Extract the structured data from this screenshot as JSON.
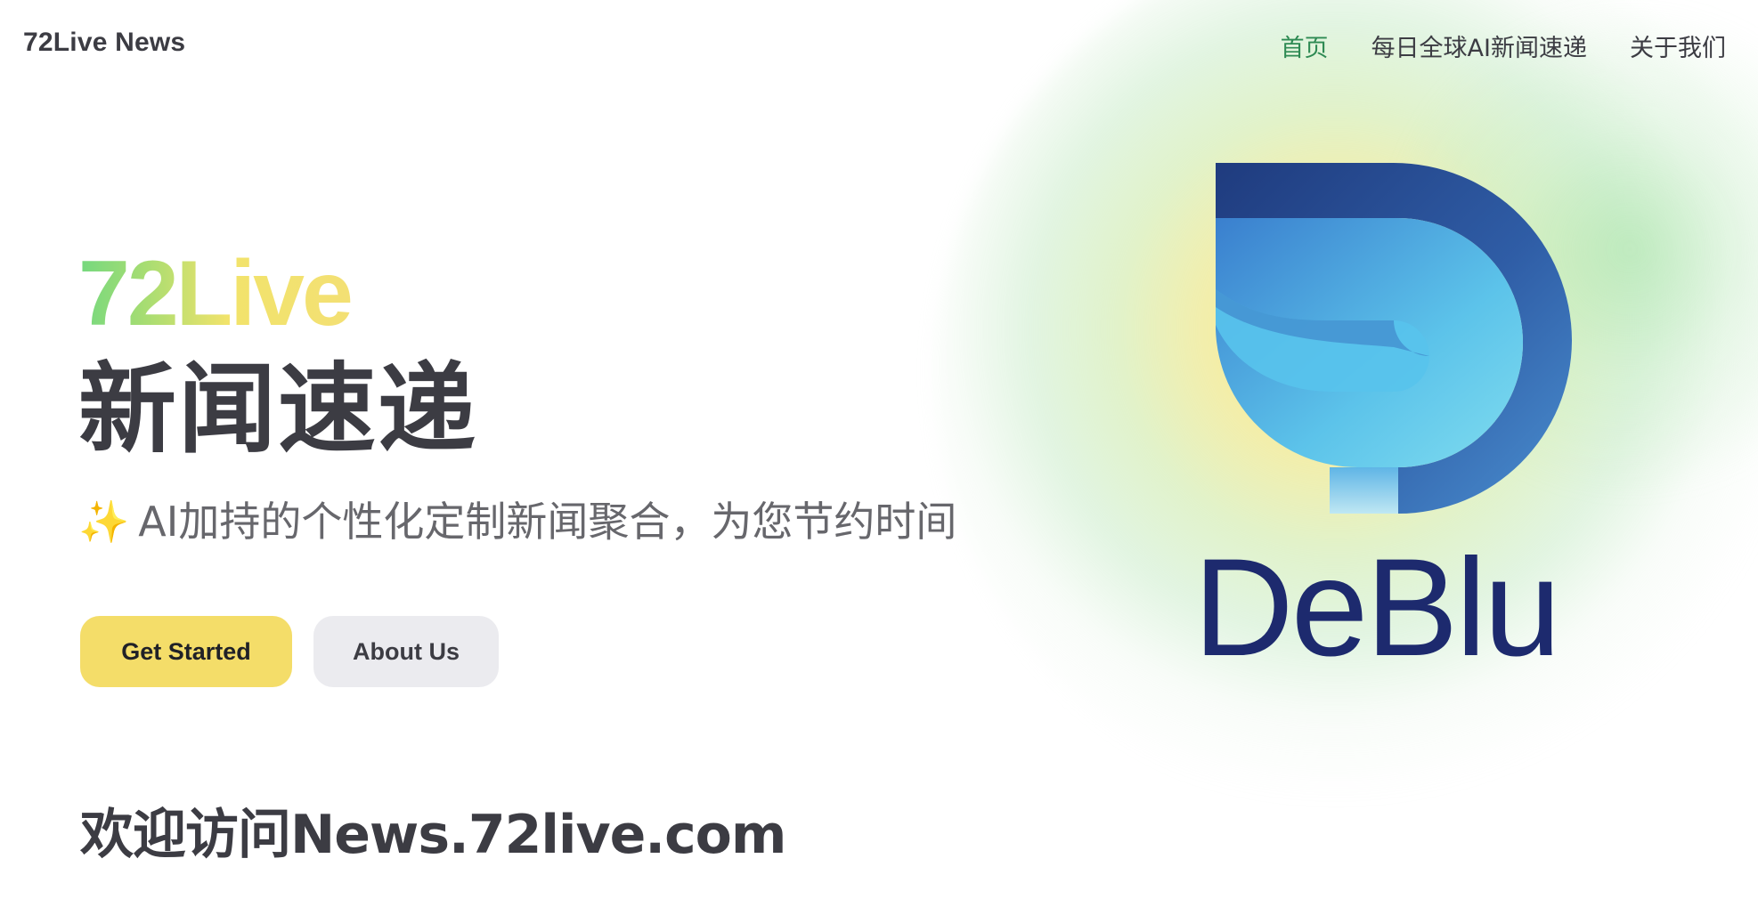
{
  "header": {
    "brand": "72Live News",
    "nav": [
      {
        "label": "首页",
        "active": true
      },
      {
        "label": "每日全球AI新闻速递",
        "active": false
      },
      {
        "label": "关于我们",
        "active": false
      }
    ]
  },
  "hero": {
    "name": "72Live",
    "title": "新闻速递",
    "tagline_icon": "✨",
    "tagline": "AI加持的个性化定制新闻聚合，为您节约时间",
    "primary_button": "Get Started",
    "secondary_button": "About Us"
  },
  "logo": {
    "wordmark": "DeBlu"
  },
  "welcome": "欢迎访问News.72live.com",
  "colors": {
    "active_nav": "#2e8a53",
    "primary_button_bg": "#f4dd69",
    "secondary_button_bg": "#ebebef",
    "text": "#3c3c43",
    "logo_navy": "#1d2a6e"
  }
}
